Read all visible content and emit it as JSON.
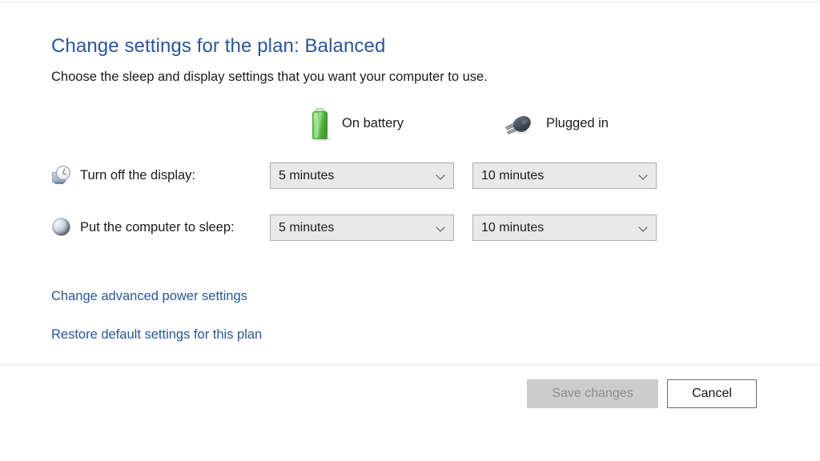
{
  "page": {
    "title": "Change settings for the plan: Balanced",
    "subtitle": "Choose the sleep and display settings that you want your computer to use."
  },
  "colors": {
    "heading_blue": "#2a5699",
    "link_blue": "#2a5699",
    "dropdown_bg": "#e9e9e9",
    "dropdown_border": "#adadad",
    "disabled_button_bg": "#cccccc",
    "disabled_button_text": "#8d8d8d",
    "battery_green": "#63c24c",
    "plug_gray": "#55606b",
    "divider": "#e6e6e6"
  },
  "columns": [
    {
      "icon": "battery-icon",
      "label": "On battery"
    },
    {
      "icon": "power-plug-icon",
      "label": "Plugged in"
    }
  ],
  "settings": [
    {
      "icon": "display-clock-icon",
      "label": "Turn off the display:",
      "on_battery": "5 minutes",
      "plugged_in": "10 minutes"
    },
    {
      "icon": "sleep-moon-icon",
      "label": "Put the computer to sleep:",
      "on_battery": "5 minutes",
      "plugged_in": "10 minutes"
    }
  ],
  "links": [
    {
      "label": "Change advanced power settings"
    },
    {
      "label": "Restore default settings for this plan"
    }
  ],
  "footer": {
    "save_label": "Save changes",
    "save_enabled": false,
    "cancel_label": "Cancel"
  }
}
